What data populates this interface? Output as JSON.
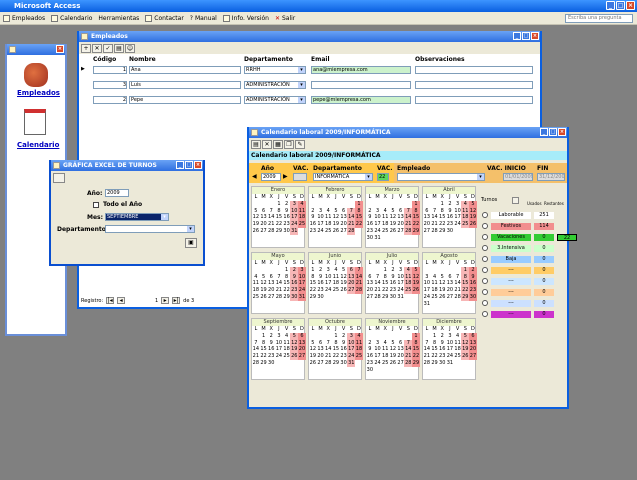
{
  "app": {
    "title": "Microsoft Access",
    "ask": "Escriba una pregunta"
  },
  "menu": [
    "Empleados",
    "Calendario",
    "Herramientas",
    "Contactar",
    "Manual",
    "Info. Versión",
    "Salir"
  ],
  "switchboard": {
    "empleados": "Empleados",
    "calendario": "Calendario"
  },
  "empleados": {
    "title": "Empleados",
    "headers": [
      "Código",
      "Nombre",
      "Departamento",
      "Email",
      "Observaciones"
    ],
    "rows": [
      {
        "codigo": "1",
        "nombre": "Ana",
        "dep": "RRHH",
        "email": "ana@miempresa.com"
      },
      {
        "codigo": "3",
        "nombre": "Luis",
        "dep": "ADMINISTRACIÓN",
        "email": ""
      },
      {
        "codigo": "2",
        "nombre": "Pepe",
        "dep": "ADMINISTRACIÓN",
        "email": "pepe@miempresa.com"
      }
    ],
    "nav": {
      "label": "Registro:",
      "current": "1",
      "of": "de  3"
    }
  },
  "grafica": {
    "title": "GRÁFICA EXCEL DE TURNOS",
    "ano_label": "Año:",
    "ano": "2009",
    "todo_label": "Todo el Año",
    "mes_label": "Mes:",
    "mes": "SEPTIEMBRE",
    "dep_label": "Departamento:",
    "dep": ""
  },
  "calendario": {
    "title": "Calendario laboral 2009/INFORMÁTICA",
    "heading": "Calendario laboral 2009/INFORMÁTICA",
    "ano_label": "Año",
    "vac_label": "VAC.",
    "ano": "2009",
    "vac": "",
    "dep_label": "Departamento",
    "dep": "INFORMÁTICA",
    "vac2_label": "VAC.",
    "vac2": "22",
    "empleado_label": "Empleado",
    "inicio_label": "VAC. INICIO",
    "fin_label": "FIN",
    "inicio": "01/01/2009",
    "fin": "31/12/2009",
    "dow": [
      "L",
      "M",
      "X",
      "J",
      "V",
      "S",
      "D"
    ],
    "months": [
      {
        "name": "Enero",
        "offset": 3,
        "days": 31
      },
      {
        "name": "Febrero",
        "offset": 6,
        "days": 28
      },
      {
        "name": "Marzo",
        "offset": 6,
        "days": 31
      },
      {
        "name": "Abril",
        "offset": 2,
        "days": 30
      },
      {
        "name": "Mayo",
        "offset": 4,
        "days": 31
      },
      {
        "name": "Junio",
        "offset": 0,
        "days": 30
      },
      {
        "name": "Julio",
        "offset": 2,
        "days": 31
      },
      {
        "name": "Agosto",
        "offset": 5,
        "days": 31
      },
      {
        "name": "Septiembre",
        "offset": 1,
        "days": 30
      },
      {
        "name": "Octubre",
        "offset": 3,
        "days": 31
      },
      {
        "name": "Noviembre",
        "offset": 6,
        "days": 30
      },
      {
        "name": "Diciembre",
        "offset": 1,
        "days": 31
      }
    ],
    "turnos": {
      "label": "Turnos",
      "usados": "Usados",
      "restantes": "Restantes",
      "rows": [
        {
          "name": "Laborable",
          "color": "#ffffff",
          "used": "251",
          "rest": ""
        },
        {
          "name": "Festivos",
          "color": "#f28e8e",
          "used": "114",
          "rest": ""
        },
        {
          "name": "Vacaciones",
          "color": "#33cc33",
          "used": "0",
          "rest": "22"
        },
        {
          "name": "3.Intensiva",
          "color": "#ccffcc",
          "used": "0",
          "rest": ""
        },
        {
          "name": "Baja",
          "color": "#99ccff",
          "used": "0",
          "rest": ""
        },
        {
          "name": "---",
          "color": "#ffcc66",
          "used": "0",
          "rest": ""
        },
        {
          "name": "---",
          "color": "#cce6ff",
          "used": "0",
          "rest": ""
        },
        {
          "name": "---",
          "color": "#ffcc99",
          "used": "0",
          "rest": ""
        },
        {
          "name": "---",
          "color": "#cce0ff",
          "used": "0",
          "rest": ""
        },
        {
          "name": "---",
          "color": "#cc33cc",
          "used": "0",
          "rest": ""
        }
      ]
    }
  }
}
